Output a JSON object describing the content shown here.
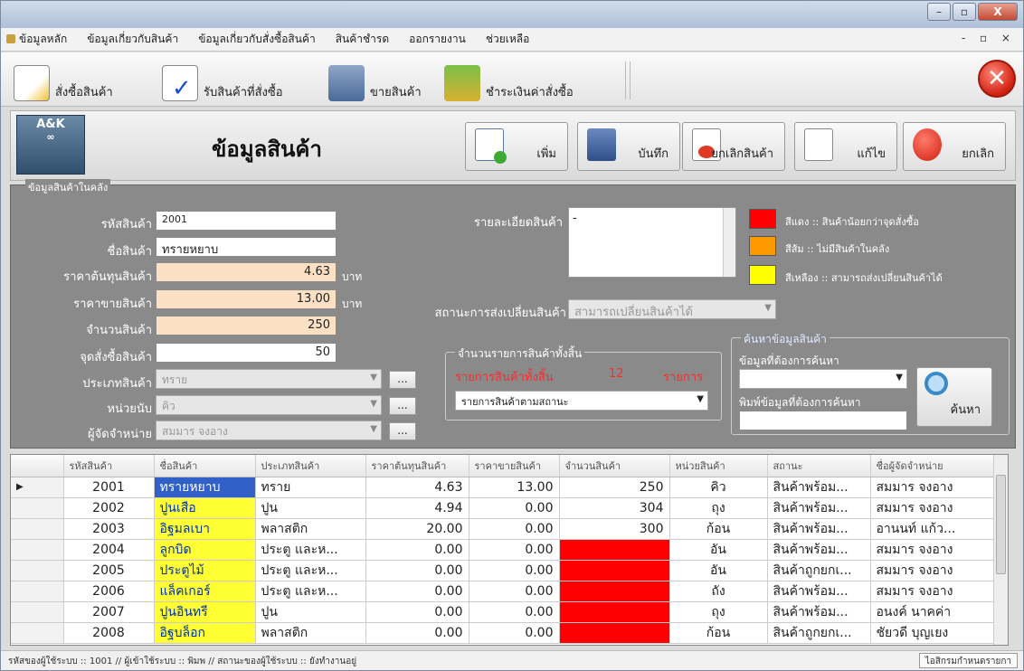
{
  "window": {
    "minimize": "–",
    "restore": "▫",
    "close": "X"
  },
  "menu": [
    "ข้อมูลหลัก",
    "ข้อมูลเกี่ยวกับสินค้า",
    "ข้อมูลเกี่ยวกับสั่งซื้อสินค้า",
    "สินค้าชำรด",
    "ออกรายงาน",
    "ช่วยเหลือ"
  ],
  "mdi_controls": "- ▫ ×",
  "toolbar": {
    "order_label": "สั่งซื้อสินค้า",
    "receive_label": "รับสินค้าที่สั่งซื้อ",
    "sell_label": "ขายสินค้า",
    "pay_label": "ชำระเงินค่าสั่งซื้อ",
    "close_glyph": "✕"
  },
  "header": {
    "logo_text": "A&K",
    "logo_sub": "∞",
    "title": "ข้อมูลสินค้า",
    "add_label": "เพิ่ม",
    "save_label": "บันทึก",
    "cancel_product_label": "ยกเลิกสินค้า",
    "edit_label": "แก้ไข",
    "cancel_label": "ยกเลิก"
  },
  "panel": {
    "legend": "ข้อมูลสินค้าในคลัง",
    "product_code_label": "รหัสสินค้า",
    "product_code": "2001",
    "product_name_label": "ชื่อสินค้า",
    "product_name": "ทรายหยาบ",
    "cost_label": "ราคาต้นทุนสินค้า",
    "cost": "4.63",
    "cost_unit": "บาท",
    "price_label": "ราคาขายสินค้า",
    "price": "13.00",
    "price_unit": "บาท",
    "qty_label": "จำนวนสินค้า",
    "qty": "250",
    "reorder_label": "จุดสั่งซื้อสินค้า",
    "reorder": "50",
    "type_label": "ประเภทสินค้า",
    "type": "ทราย",
    "unit_label": "หน่วยนับ",
    "unit": "คิว",
    "supplier_label": "ผู้จัดจำหน่าย",
    "supplier": "สมมาร จงอาง",
    "dots": "...",
    "detail_label": "รายละเอียดสินค้า",
    "detail": "-",
    "exchange_label": "สถานะการส่งเปลี่ยนสินค้า",
    "exchange": "สามารถเปลี่ยนสินค้าได้",
    "legend_red": "สีแดง :: สินค้าน้อยกว่าจุดสั่งซื้อ",
    "legend_orange": "สีส้ม :: ไม่มีสินค้าในคลัง",
    "legend_yellow": "สีเหลือง :: สามารถส่งเปลี่ยนสินค้าได้",
    "total_group": "จำนวนรายการสินค้าทั้งสิ้น",
    "total_prefix": "รายการสินค้าทั้งสิ้น",
    "total_count": "12",
    "total_suffix": "รายการ",
    "status_filter": "รายการสินค้าตามสถานะ",
    "search_group": "ค้นหาข้อมูลสินค้า",
    "search_field_label": "ข้อมูลที่ต้องการค้นหา",
    "search_text_label": "พิมพ์ข้อมูลที่ต้องการค้นหา",
    "search_button": "ค้นหา"
  },
  "colors": {
    "red": "#ff0000",
    "orange": "#ff9900",
    "yellow": "#ffff00"
  },
  "grid": {
    "columns": [
      "",
      "รหัสสินค้า",
      "ชื่อสินค้า",
      "ประเภทสินค้า",
      "ราคาต้นทุนสินค้า",
      "ราคาขายสินค้า",
      "จำนวนสินค้า",
      "หน่วยสินค้า",
      "สถานะ",
      "ชื่อผู้จัดจำหน่าย"
    ],
    "rows": [
      {
        "marker": "▶",
        "code": "2001",
        "name": "ทรายหยาบ",
        "type": "ทราย",
        "cost": "4.63",
        "price": "13.00",
        "qty": "250",
        "unit": "คิว",
        "status": "สินค้าพร้อม...",
        "supplier": "สมมาร จงอาง"
      },
      {
        "marker": "",
        "code": "2002",
        "name": "ปูนเสือ",
        "type": "ปูน",
        "cost": "4.94",
        "price": "0.00",
        "qty": "304",
        "unit": "ถุง",
        "status": "สินค้าพร้อม...",
        "supplier": "สมมาร จงอาง"
      },
      {
        "marker": "",
        "code": "2003",
        "name": "อิฐมลเบา",
        "type": "พลาสติก",
        "cost": "20.00",
        "price": "0.00",
        "qty": "300",
        "unit": "ก้อน",
        "status": "สินค้าพร้อม...",
        "supplier": "อานนท์ แก้ว..."
      },
      {
        "marker": "",
        "code": "2004",
        "name": "ลูกบิด",
        "type": "ประตู และห...",
        "cost": "0.00",
        "price": "0.00",
        "qty": "0",
        "unit": "อัน",
        "status": "สินค้าพร้อม...",
        "supplier": "สมมาร จงอาง"
      },
      {
        "marker": "",
        "code": "2005",
        "name": "ประตูไม้",
        "type": "ประตู และห...",
        "cost": "0.00",
        "price": "0.00",
        "qty": "0",
        "unit": "อัน",
        "status": "สินค้าถูกยกเ...",
        "supplier": "สมมาร จงอาง"
      },
      {
        "marker": "",
        "code": "2006",
        "name": "แล็คเกอร์",
        "type": "ประตู และห...",
        "cost": "0.00",
        "price": "0.00",
        "qty": "0",
        "unit": "ถัง",
        "status": "สินค้าพร้อม...",
        "supplier": "สมมาร จงอาง"
      },
      {
        "marker": "",
        "code": "2007",
        "name": "ปูนอินทรี",
        "type": "ปูน",
        "cost": "0.00",
        "price": "0.00",
        "qty": "0",
        "unit": "ถุง",
        "status": "สินค้าพร้อม...",
        "supplier": "อนงค์ นาคค่า"
      },
      {
        "marker": "",
        "code": "2008",
        "name": "อิฐบล็อก",
        "type": "พลาสติก",
        "cost": "0.00",
        "price": "0.00",
        "qty": "0",
        "unit": "ก้อน",
        "status": "สินค้าถูกยกเ...",
        "supplier": "ชัยวดี บุญเยง"
      }
    ]
  },
  "status": {
    "text": "รหัสของผู้ใช้ระบบ :: 1001 //  ผู้เข้าใช้ระบบ :: พิมพ //  สถานะของผู้ใช้ระบบ :: ยังทำงานอยู่",
    "button": "ไอสิกรมกำหนดรายกา"
  }
}
